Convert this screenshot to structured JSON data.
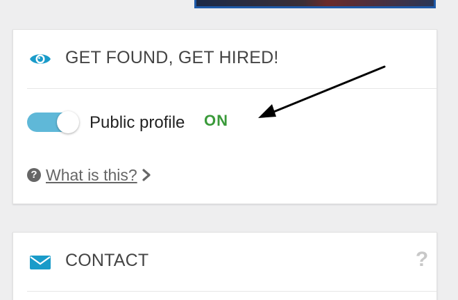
{
  "visibility_card": {
    "title": "GET FOUND, GET HIRED!",
    "icon": "eye-icon",
    "toggle": {
      "label": "Public profile",
      "state": "ON",
      "on": true
    },
    "help": {
      "link": "What is this?",
      "icon": "question-circle-icon"
    }
  },
  "contact_card": {
    "title": "CONTACT",
    "icon": "envelope-icon",
    "help_glyph": "?"
  },
  "colors": {
    "accent": "#1a9bc9",
    "toggle_track": "#5fb8d8",
    "on_green": "#3a9a3a",
    "annotation_arrow": "#000000"
  }
}
